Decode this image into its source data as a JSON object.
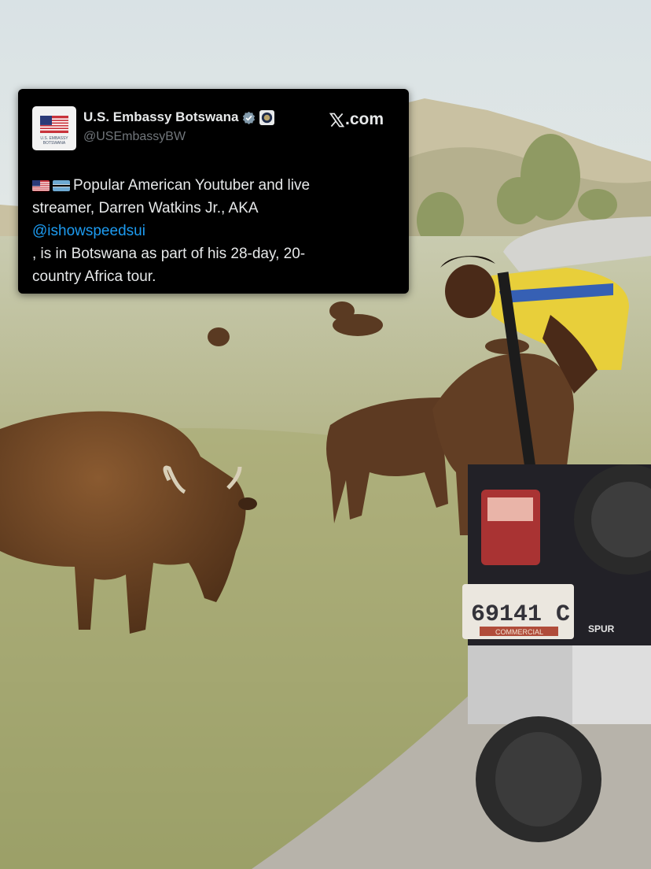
{
  "tweet": {
    "account_name": "U.S. Embassy Botswana",
    "handle": "@USEmbassyBW",
    "site_label": ".com",
    "avatar_caption": "U.S. EMBASSY BOTSWANA",
    "text_line1": "Popular American Youtuber and live",
    "text_line2": "streamer, Darren Watkins Jr., AKA",
    "mention": "@ishowspeedsui",
    "text_line4": ", is in Botswana as part of his 28-day, 20-",
    "text_line5": "country Africa tour.",
    "icons": [
      "us-flag-icon",
      "botswana-flag-icon",
      "verified-badge-icon",
      "government-seal-icon",
      "x-logo-icon"
    ]
  },
  "photo": {
    "license_plate": "69141 C",
    "plate_banner": "COMMERCIAL",
    "tire_brand": "SPUR"
  },
  "colors": {
    "card_background": "#000000",
    "text": "#e7e9ea",
    "handle": "#71767b",
    "mention": "#1d9bf0",
    "verified": "#829aab",
    "sky": "#dfe6e9",
    "grass": "#a9ab78"
  }
}
